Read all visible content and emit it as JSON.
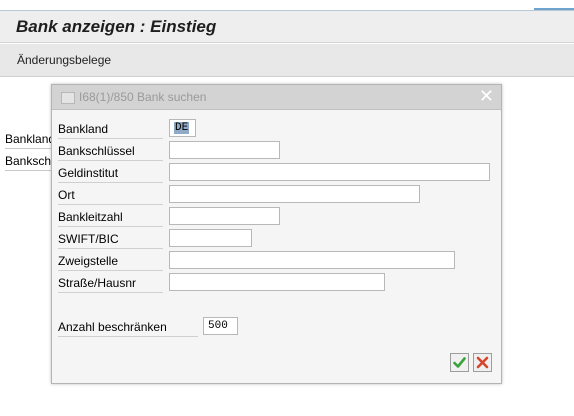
{
  "header": {
    "title": "Bank anzeigen : Einstieg"
  },
  "toolbar": {
    "change_docs": "Änderungsbelege"
  },
  "background_fields": {
    "bankland": "Bankland",
    "bankschluessel": "Bankschl"
  },
  "dialog": {
    "title": "I68(1)/850 Bank suchen",
    "fields": {
      "bankland": {
        "label": "Bankland",
        "value": "DE"
      },
      "bankschluessel": {
        "label": "Bankschlüssel",
        "value": ""
      },
      "geldinstitut": {
        "label": "Geldinstitut",
        "value": ""
      },
      "ort": {
        "label": "Ort",
        "value": ""
      },
      "bankleitzahl": {
        "label": "Bankleitzahl",
        "value": ""
      },
      "swift": {
        "label": "SWIFT/BIC",
        "value": ""
      },
      "zweigstelle": {
        "label": "Zweigstelle",
        "value": ""
      },
      "strasse": {
        "label": "Straße/Hausnr",
        "value": ""
      },
      "anzahl": {
        "label": "Anzahl beschränken",
        "value": "500"
      }
    },
    "icons": {
      "confirm": "check-icon",
      "cancel": "cross-icon",
      "close": "close-icon"
    },
    "colors": {
      "confirm": "#3aa23a",
      "cancel": "#d6452c"
    }
  }
}
